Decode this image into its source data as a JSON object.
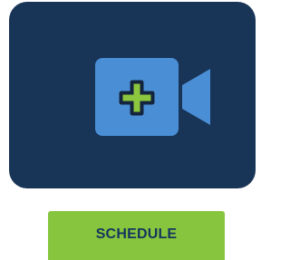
{
  "tile": {
    "icon": "video-camera-add-icon",
    "background_color": "#183457",
    "icon_color": "#4a8fd6",
    "plus_color": "#8cc63f",
    "plus_outline_color": "#14243d"
  },
  "actions": {
    "schedule_label": "SCHEDULE",
    "button_color": "#86c53d",
    "label_color": "#14365e"
  }
}
